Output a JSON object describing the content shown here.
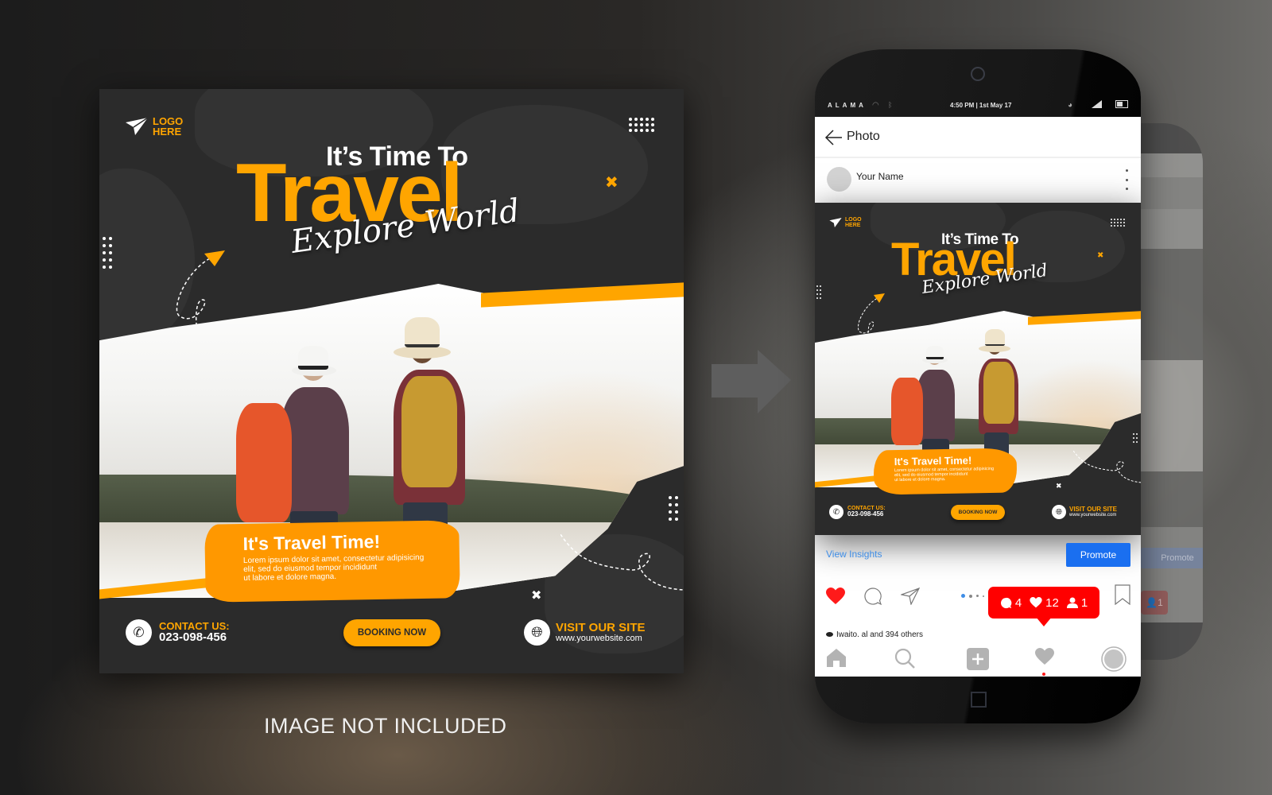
{
  "flyer": {
    "logo_text_line1": "LOGO",
    "logo_text_line2": "HERE",
    "headline_pre": "It’s Time To",
    "headline_main": "Travel",
    "headline_script": "Explore World",
    "promo_title": "It's Travel Time!",
    "promo_desc_line1": "Lorem ipsum dolor sit amet, consectetur adipisicing",
    "promo_desc_line2": "elit, sed do eiusmod tempor incididunt",
    "promo_desc_line3": "ut labore et dolore magna.",
    "contact_label": "CONTACT US:",
    "contact_phone": "023-098-456",
    "booking_label": "BOOKING NOW",
    "site_label": "VISIT OUR SITE",
    "site_url": "www.yourwebsite.com",
    "icons": {
      "logo": "paper-plane-icon",
      "contact": "phone-icon",
      "site": "globe-icon",
      "decor_cross": "cross-icon",
      "decor_arrow": "arrow-icon"
    }
  },
  "caption": "IMAGE NOT INCLUDED",
  "phone": {
    "status_bar": {
      "carrier": "ALAMA",
      "time": "4:50 PM | 1st May 17"
    },
    "topbar": {
      "title": "Photo"
    },
    "user": {
      "name": "Your Name"
    },
    "insights": {
      "view_insights": "View Insights",
      "promote": "Promote"
    },
    "notification": {
      "comments": "4",
      "likes": "12",
      "followers": "1"
    },
    "likes_line": "Iwaito. al  and 394 others",
    "pager": {
      "total": 4,
      "active": 1
    }
  },
  "colors": {
    "accent_orange": "#ffa500",
    "dark_bg": "#2b2b2b",
    "promote_blue": "#1a6ff0",
    "notif_red": "#ff0000",
    "link_blue": "#3e8de6"
  }
}
